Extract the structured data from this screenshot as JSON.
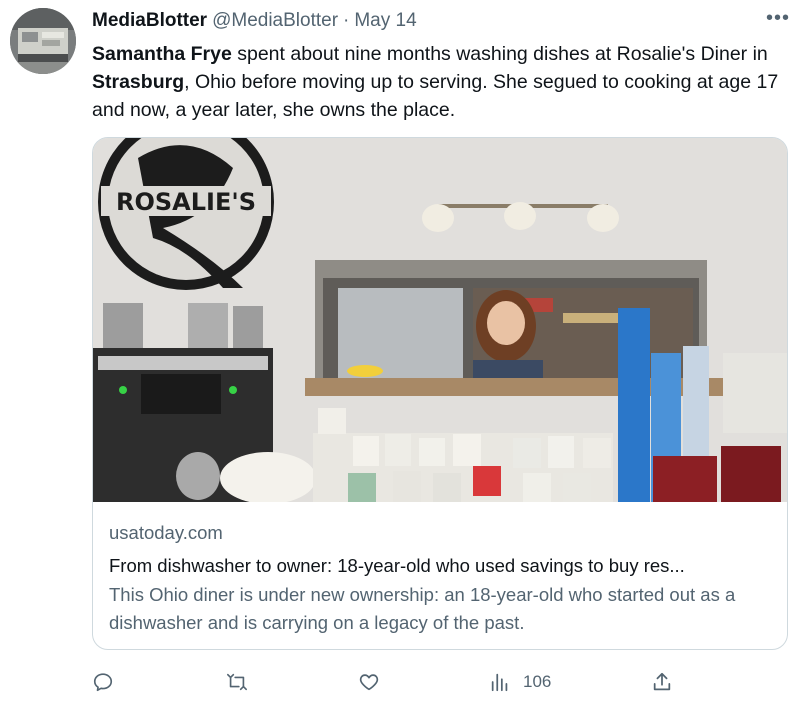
{
  "author": {
    "display_name": "MediaBlotter",
    "handle": "@MediaBlotter",
    "separator": "·",
    "date": "May 14"
  },
  "menu": {
    "more_icon": "more-horizontal-icon",
    "more_label": "•••"
  },
  "tweet": {
    "text_bold_1": "Samantha Frye",
    "text_1": " spent about nine months washing dishes at Rosalie's Diner in ",
    "text_bold_2": "Strasburg",
    "text_2": ", Ohio before moving up to serving. She segued to cooking at age 17 and now, a year later, she owns the place."
  },
  "card": {
    "image_sign_text": "ROSALIE'S",
    "domain": "usatoday.com",
    "title": "From dishwasher to owner: 18-year-old who used savings to buy res...",
    "description": "This Ohio diner is under new ownership: an 18-year-old who started out as a dishwasher and is carrying on a legacy of the past."
  },
  "actions": {
    "reply_icon": "reply-icon",
    "retweet_icon": "retweet-icon",
    "like_icon": "heart-icon",
    "views_icon": "views-icon",
    "views_count": "106",
    "share_icon": "share-icon"
  },
  "colors": {
    "text_primary": "#0f1419",
    "text_secondary": "#536471",
    "border": "#cfd9de"
  }
}
